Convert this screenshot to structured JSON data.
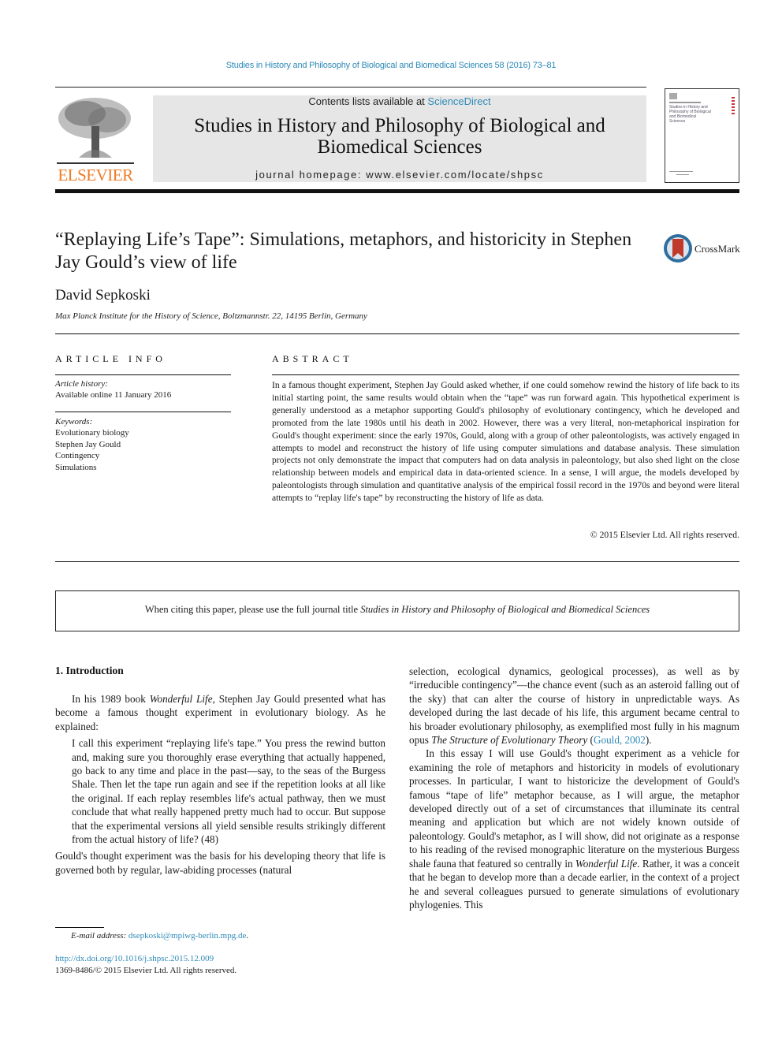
{
  "running_head": "Studies in History and Philosophy of Biological and Biomedical Sciences 58 (2016) 73–81",
  "masthead": {
    "publisher_logo_text": "ELSEVIER",
    "contents_prefix": "Contents lists available at ",
    "contents_link": "ScienceDirect",
    "journal_title": "Studies in History and Philosophy of Biological and Biomedical Sciences",
    "homepage_label": "journal homepage: www.elsevier.com/locate/shpsc",
    "cover_title": "Studies in History and Philosophy of Biological and Biomedical Sciences"
  },
  "colors": {
    "link": "#2e8ab8",
    "elsevier_orange": "#f07a24",
    "banner_gray": "#e6e6e6",
    "crossmark_red": "#c0392b",
    "crossmark_blue": "#2f6e9e"
  },
  "article": {
    "title": "“Replaying Life’s Tape”: Simulations, metaphors, and historicity in Stephen Jay Gould’s view of life",
    "crossmark_label": "CrossMark",
    "author": "David Sepkoski",
    "affiliation": "Max Planck Institute for the History of Science, Boltzmannstr. 22, 14195 Berlin, Germany"
  },
  "article_info": {
    "heading": "ARTICLE INFO",
    "history_label": "Article history:",
    "history_value": "Available online 11 January 2016",
    "keywords_label": "Keywords:",
    "keywords": [
      "Evolutionary biology",
      "Stephen Jay Gould",
      "Contingency",
      "Simulations"
    ]
  },
  "abstract": {
    "heading": "ABSTRACT",
    "text": "In a famous thought experiment, Stephen Jay Gould asked whether, if one could somehow rewind the history of life back to its initial starting point, the same results would obtain when the “tape” was run forward again. This hypothetical experiment is generally understood as a metaphor supporting Gould's philosophy of evolutionary contingency, which he developed and promoted from the late 1980s until his death in 2002. However, there was a very literal, non-metaphorical inspiration for Gould's thought experiment: since the early 1970s, Gould, along with a group of other paleontologists, was actively engaged in attempts to model and reconstruct the history of life using computer simulations and database analysis. These simulation projects not only demonstrate the impact that computers had on data analysis in paleontology, but also shed light on the close relationship between models and empirical data in data-oriented science. In a sense, I will argue, the models developed by paleontologists through simulation and quantitative analysis of the empirical fossil record in the 1970s and beyond were literal attempts to “replay life's tape” by reconstructing the history of life as data.",
    "copyright": "© 2015 Elsevier Ltd. All rights reserved."
  },
  "citation_notice": {
    "prefix": "When citing this paper, please use the full journal title ",
    "journal": "Studies in History and Philosophy of Biological and Biomedical Sciences"
  },
  "body": {
    "section_heading": "1.  Introduction",
    "p1_a": "In his 1989 book ",
    "p1_book": "Wonderful Life",
    "p1_b": ", Stephen Jay Gould presented what has become a famous thought experiment in evolutionary biology. As he explained:",
    "quote": "I call this experiment “replaying life's tape.” You press the rewind button and, making sure you thoroughly erase everything that actually happened, go back to any time and place in the past—say, to the seas of the Burgess Shale. Then let the tape run again and see if the repetition looks at all like the original. If each replay resembles life's actual pathway, then we must conclude that what really happened pretty much had to occur. But suppose that the experimental versions all yield sensible results strikingly different from the actual history of life? (48)",
    "p2_left": "Gould's thought experiment was the basis for his developing theory that life is governed both by regular, law-abiding processes (natural",
    "p2_right_a": "selection, ecological dynamics, geological processes), as well as by “irreducible contingency”—the chance event (such as an asteroid falling out of the sky) that can alter the course of history in unpredictable ways. As developed during the last decade of his life, this argument became central to his broader evolutionary philosophy, as exemplified most fully in his magnum opus ",
    "p2_right_book": "The Structure of Evolutionary Theory",
    "p2_right_open": " (",
    "p2_right_cite": "Gould, 2002",
    "p2_right_close": ").",
    "p3_a": "In this essay I will use Gould's thought experiment as a vehicle for examining the role of metaphors and historicity in models of evolutionary processes. In particular, I want to historicize the development of Gould's famous “tape of life” metaphor because, as I will argue, the metaphor developed directly out of a set of circumstances that illuminate its central meaning and application but which are not widely known outside of paleontology. Gould's metaphor, as I will show, did not originate as a response to his reading of the revised monographic literature on the mysterious Burgess shale fauna that featured so centrally in ",
    "p3_book": "Wonderful Life",
    "p3_b": ". Rather, it was a conceit that he began to develop more than a decade earlier, in the context of a project he and several colleagues pursued to generate simulations of evolutionary phylogenies. This"
  },
  "footer": {
    "email_label": "E-mail address: ",
    "email": "dsepkoski@mpiwg-berlin.mpg.de",
    "email_end": ".",
    "doi": "http://dx.doi.org/10.1016/j.shpsc.2015.12.009",
    "issn": "1369-8486/© 2015 Elsevier Ltd. All rights reserved."
  }
}
